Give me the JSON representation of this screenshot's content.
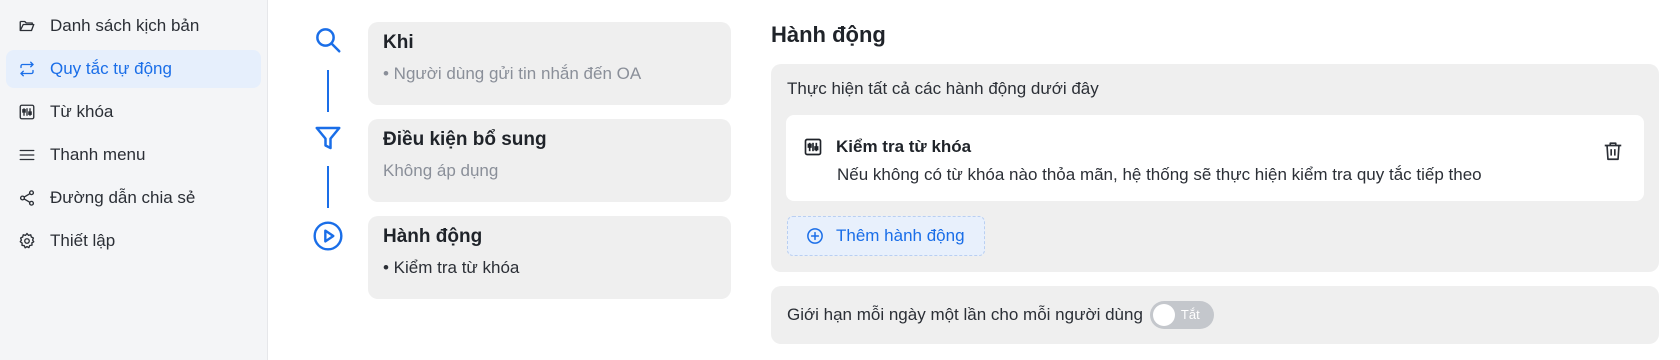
{
  "sidebar": {
    "items": [
      {
        "label": "Danh sách kịch bản",
        "icon": "folder-open-icon"
      },
      {
        "label": "Quy tắc tự động",
        "icon": "repeat-icon",
        "active": true
      },
      {
        "label": "Từ khóa",
        "icon": "keyword-sliders-icon"
      },
      {
        "label": "Thanh menu",
        "icon": "menu-icon"
      },
      {
        "label": "Đường dẫn chia sẻ",
        "icon": "share-icon"
      },
      {
        "label": "Thiết lập",
        "icon": "gear-icon"
      }
    ]
  },
  "steps": [
    {
      "title": "Khi",
      "subtitle": "• Người dùng gửi tin nhắn đến OA",
      "icon": "search-icon"
    },
    {
      "title": "Điều kiện bổ sung",
      "subtitle": "Không áp dụng",
      "icon": "filter-icon"
    },
    {
      "title": "Hành động",
      "subtitle": "• Kiểm tra từ khóa",
      "icon": "play-circle-icon"
    }
  ],
  "action_panel": {
    "heading": "Hành động",
    "description": "Thực hiện tất cả các hành động dưới đây",
    "action_item": {
      "title": "Kiểm tra từ khóa",
      "description": "Nếu không có từ khóa nào thỏa mãn, hệ thống sẽ thực hiện kiểm tra quy tắc tiếp theo"
    },
    "add_label": "Thêm hành động"
  },
  "limit": {
    "label": "Giới hạn mỗi ngày một lần cho mỗi người dùng",
    "toggle_label": "Tắt",
    "enabled": false
  },
  "colors": {
    "accent": "#1a6ee8",
    "card_bg": "#efefef",
    "sidebar_bg": "#f4f5f7"
  }
}
